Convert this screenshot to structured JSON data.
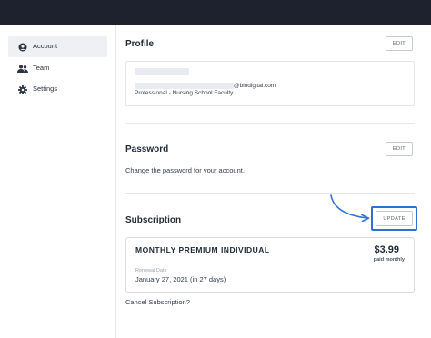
{
  "sidebar": {
    "items": [
      {
        "label": "Account",
        "icon": "user-circle-icon",
        "active": true
      },
      {
        "label": "Team",
        "icon": "team-icon",
        "active": false
      },
      {
        "label": "Settings",
        "icon": "gear-icon",
        "active": false
      }
    ]
  },
  "profile": {
    "title": "Profile",
    "edit_label": "EDIT",
    "email_suffix": "@biodigital.com",
    "role": "Professional - Nursing School Faculty"
  },
  "password": {
    "title": "Password",
    "edit_label": "EDIT",
    "description": "Change the password for your account."
  },
  "subscription": {
    "title": "Subscription",
    "update_label": "UPDATE",
    "plan": "MONTHLY PREMIUM INDIVIDUAL",
    "renewal_label": "Renewal Date",
    "renewal_date": "January 27, 2021 (in 27 days)",
    "price": "$3.99",
    "period": "paid monthly",
    "cancel_link": "Cancel Subscription?"
  },
  "colors": {
    "topbar": "#1d222e",
    "highlight": "#2f6fd6",
    "arrow": "#2f6fd6"
  }
}
